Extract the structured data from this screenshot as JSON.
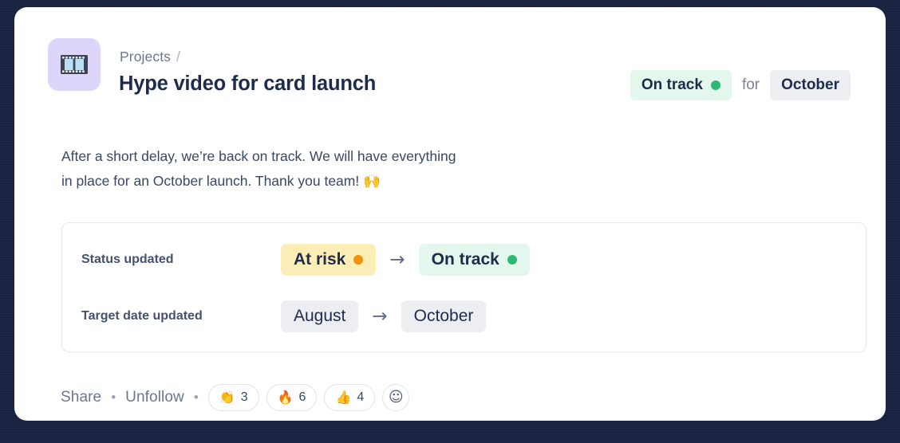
{
  "header": {
    "icon_name": "film-strip-icon",
    "breadcrumb_parent": "Projects",
    "breadcrumb_separator": "/",
    "title": "Hype video for card launch",
    "status_label": "On track",
    "status_dot_color": "#2eb872",
    "for_label": "for",
    "target_month": "October"
  },
  "body": {
    "line1": "After a short delay, we’re back on track. We will have everything",
    "line2": "in place for an October launch. Thank you team!",
    "emoji": "🙌"
  },
  "update_card": {
    "rows": [
      {
        "label": "Status updated",
        "from": "At risk",
        "from_dot_color": "#f79009",
        "arrow": "→",
        "to": "On track",
        "to_dot_color": "#2eb872"
      },
      {
        "label": "Target date updated",
        "from": "August",
        "arrow": "→",
        "to": "October"
      }
    ]
  },
  "footer": {
    "share_label": "Share",
    "separator": "•",
    "unfollow_label": "Unfollow",
    "reactions": [
      {
        "emoji": "👏",
        "name": "clap-reaction",
        "count": "3"
      },
      {
        "emoji": "🔥",
        "name": "fire-reaction",
        "count": "6"
      },
      {
        "emoji": "👍",
        "name": "thumbs-up-reaction",
        "count": "4"
      }
    ],
    "add_reaction_icon": "☺"
  }
}
